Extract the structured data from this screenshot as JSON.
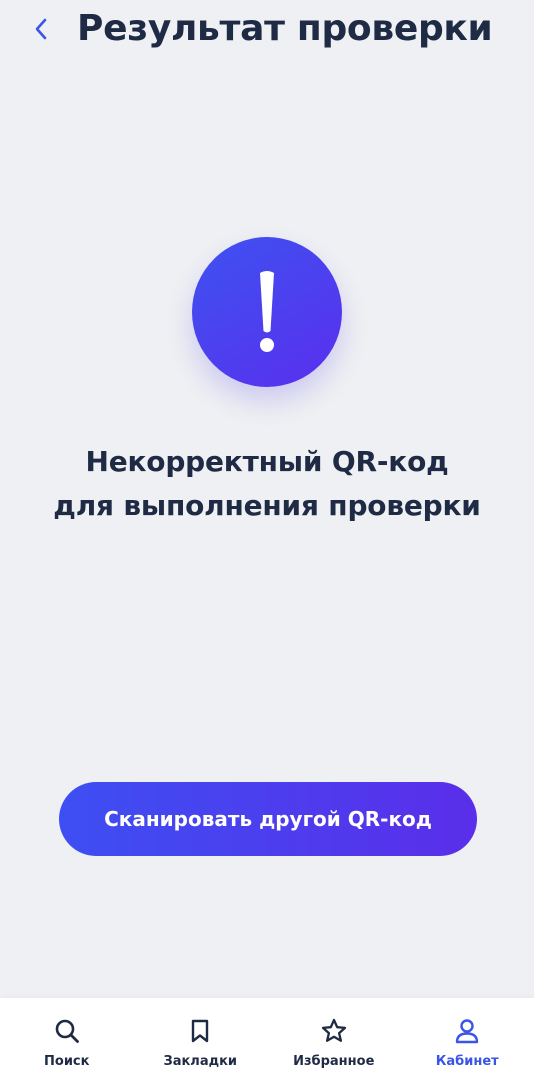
{
  "header": {
    "title": "Результат проверки",
    "back_icon": "chevron-left-icon"
  },
  "result": {
    "icon": "exclamation-icon",
    "message_line1": "Некорректный QR-код",
    "message_line2": "для выполнения проверки"
  },
  "actions": {
    "scan_label": "Сканировать другой QR-код"
  },
  "bottom_nav": {
    "items": [
      {
        "label": "Поиск",
        "icon": "search-icon"
      },
      {
        "label": "Закладки",
        "icon": "bookmark-icon"
      },
      {
        "label": "Избранное",
        "icon": "star-icon"
      },
      {
        "label": "Кабинет",
        "icon": "user-icon",
        "active": true
      }
    ]
  },
  "colors": {
    "accent": "#3b55e6",
    "accent_gradient_end": "#5a2eea",
    "text": "#1f2a44",
    "background": "#eef0f3"
  }
}
